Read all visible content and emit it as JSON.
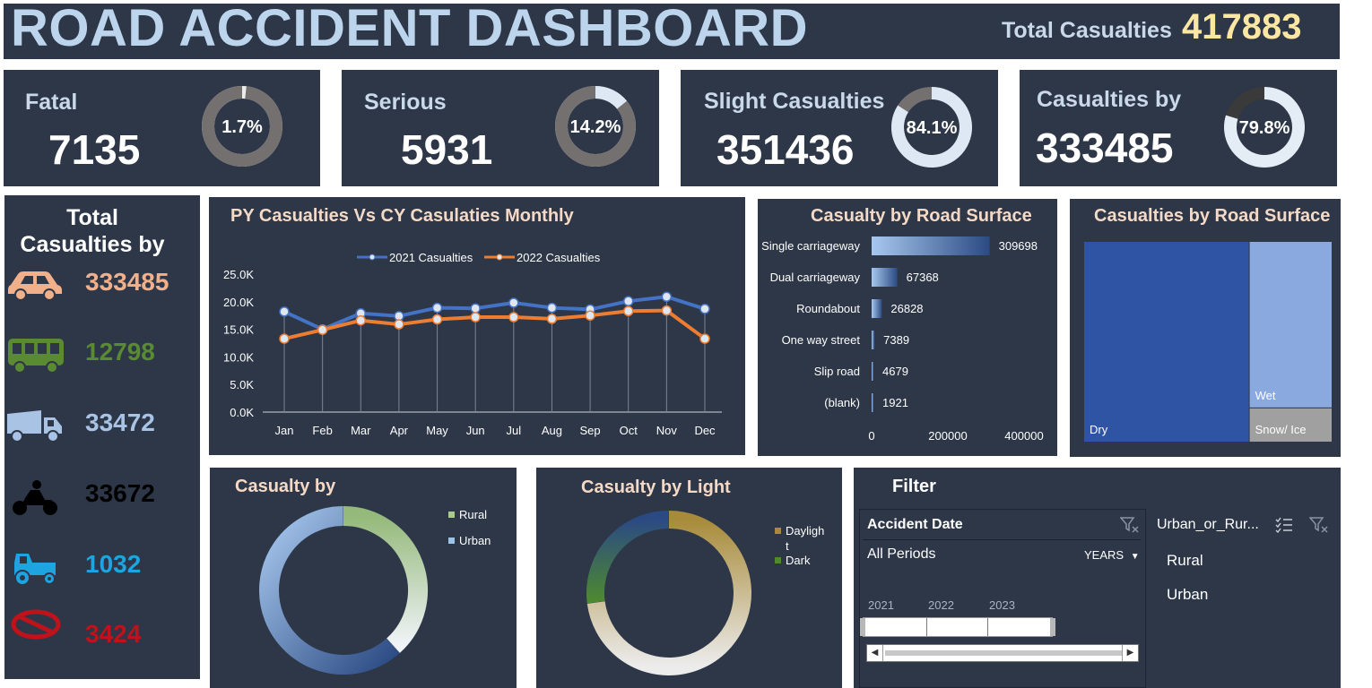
{
  "header": {
    "title": "ROAD ACCIDENT DASHBOARD",
    "total_label": "Total Casualties",
    "total_value": "417883"
  },
  "kpis": [
    {
      "label": "Fatal",
      "value": "7135",
      "pct_label": "1.7%",
      "pct": 1.7
    },
    {
      "label": "Serious",
      "value": "5931",
      "pct_label": "14.2%",
      "pct": 14.2
    },
    {
      "label": "Slight Casualties",
      "value": "351436",
      "pct_label": "84.1%",
      "pct": 84.1
    },
    {
      "label": "Casualties by",
      "value": "333485",
      "pct_label": "79.8%",
      "pct": 79.8
    }
  ],
  "vehicles": {
    "title_line1": "Total",
    "title_line2": "Casualties by",
    "items": [
      {
        "icon": "car-icon",
        "value": "333485",
        "color": "#f2b08a"
      },
      {
        "icon": "bus-icon",
        "value": "12798",
        "color": "#5a8a32"
      },
      {
        "icon": "truck-icon",
        "value": "33472",
        "color": "#a9c3e4"
      },
      {
        "icon": "motorcycle-icon",
        "value": "33672",
        "color": "#000000"
      },
      {
        "icon": "tractor-icon",
        "value": "1032",
        "color": "#1ea4e0"
      },
      {
        "icon": "no-entry-icon",
        "value": "3424",
        "color": "#c0121a"
      }
    ]
  },
  "monthly_chart": {
    "title": "PY Casualties Vs CY Casulaties Monthly"
  },
  "road_type_chart": {
    "title": "Casualty by Road Surface"
  },
  "road_surface_chart": {
    "title": "Casualties by Road Surface"
  },
  "area_chart": {
    "title": "Casualty by"
  },
  "light_chart": {
    "title": "Casualty by Light"
  },
  "filter": {
    "title": "Filter",
    "date_slicer": {
      "title": "Accident Date",
      "periods": "All Periods",
      "level": "YEARS",
      "years": [
        "2021",
        "2022",
        "2023"
      ]
    },
    "area_slicer": {
      "title": "Urban_or_Rur...",
      "items": [
        "Rural",
        "Urban"
      ]
    }
  },
  "chart_data": [
    {
      "type": "line",
      "title": "PY Casualties Vs CY Casulaties Monthly",
      "categories": [
        "Jan",
        "Feb",
        "Mar",
        "Apr",
        "May",
        "Jun",
        "Jul",
        "Aug",
        "Sep",
        "Oct",
        "Nov",
        "Dec"
      ],
      "series": [
        {
          "name": "2021 Casualties",
          "color": "#4472c4",
          "values": [
            18200,
            15000,
            17900,
            17400,
            18900,
            18800,
            19800,
            18900,
            18600,
            20100,
            20900,
            18700
          ]
        },
        {
          "name": "2022 Casualties",
          "color": "#ed7d31",
          "values": [
            13300,
            14900,
            16600,
            15900,
            16800,
            17200,
            17200,
            16900,
            17500,
            18300,
            18400,
            13300
          ]
        }
      ],
      "yticks": [
        "0.0K",
        "5.0K",
        "10.0K",
        "15.0K",
        "20.0K",
        "25.0K"
      ],
      "ylim": [
        0,
        25000
      ],
      "legend": "top"
    },
    {
      "type": "bar",
      "title": "Casualty by Road Surface",
      "categories": [
        "Single carriageway",
        "Dual carriageway",
        "Roundabout",
        "One way street",
        "Slip road",
        "(blank)"
      ],
      "values": [
        309698,
        67368,
        26828,
        7389,
        4679,
        1921
      ],
      "xticks": [
        "0",
        "200000",
        "400000"
      ],
      "xlim": [
        0,
        400000
      ]
    },
    {
      "type": "treemap",
      "title": "Casualties by Road Surface",
      "categories": [
        "Dry",
        "Wet",
        "Snow/ Ice"
      ],
      "values": [
        279445,
        115361,
        23077
      ],
      "colors": [
        "#2f54a3",
        "#8aa9de",
        "#a0a0a0"
      ]
    },
    {
      "type": "pie",
      "title": "Casualty by",
      "categories": [
        "Rural",
        "Urban"
      ],
      "values": [
        38.4,
        61.6
      ],
      "colors": [
        "#a9cb8c",
        "#9dc3e6"
      ],
      "legend": "right"
    },
    {
      "type": "pie",
      "title": "Casualty by Light",
      "categories": [
        "Daylight",
        "Dark"
      ],
      "legend_labels": [
        "Dayligh",
        "t",
        "Dark"
      ],
      "values": [
        73.0,
        27.0
      ],
      "colors": [
        "#a88b3a",
        "#4e8a2e"
      ],
      "legend": "right"
    }
  ]
}
